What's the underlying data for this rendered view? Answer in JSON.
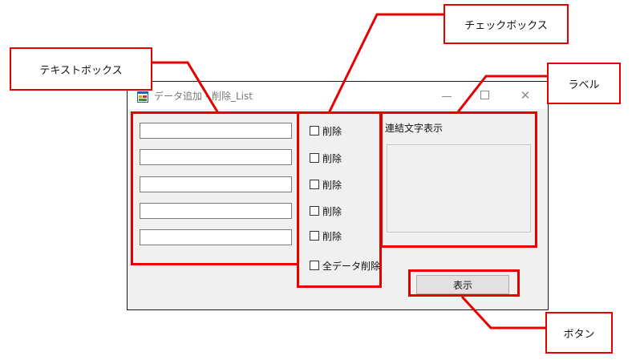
{
  "window": {
    "title": "データ追加・削除_List",
    "icon": "form-app-icon",
    "controls": {
      "minimize": "minimize-icon",
      "maximize": "maximize-icon",
      "close": "✕"
    }
  },
  "textboxes": [
    {
      "value": ""
    },
    {
      "value": ""
    },
    {
      "value": ""
    },
    {
      "value": ""
    },
    {
      "value": ""
    }
  ],
  "checkboxes": [
    {
      "label": "削除",
      "checked": false
    },
    {
      "label": "削除",
      "checked": false
    },
    {
      "label": "削除",
      "checked": false
    },
    {
      "label": "削除",
      "checked": false
    },
    {
      "label": "削除",
      "checked": false
    }
  ],
  "delete_all": {
    "label": "全データ削除",
    "checked": false
  },
  "concat_label": "連結文字表示",
  "button": {
    "label": "表示"
  },
  "annotations": {
    "textbox": "テキストボックス",
    "checkbox": "チェックボックス",
    "label": "ラベル",
    "button": "ボタン"
  },
  "colors": {
    "annotation": "#e60000",
    "window_bg": "#f0f0f0"
  }
}
